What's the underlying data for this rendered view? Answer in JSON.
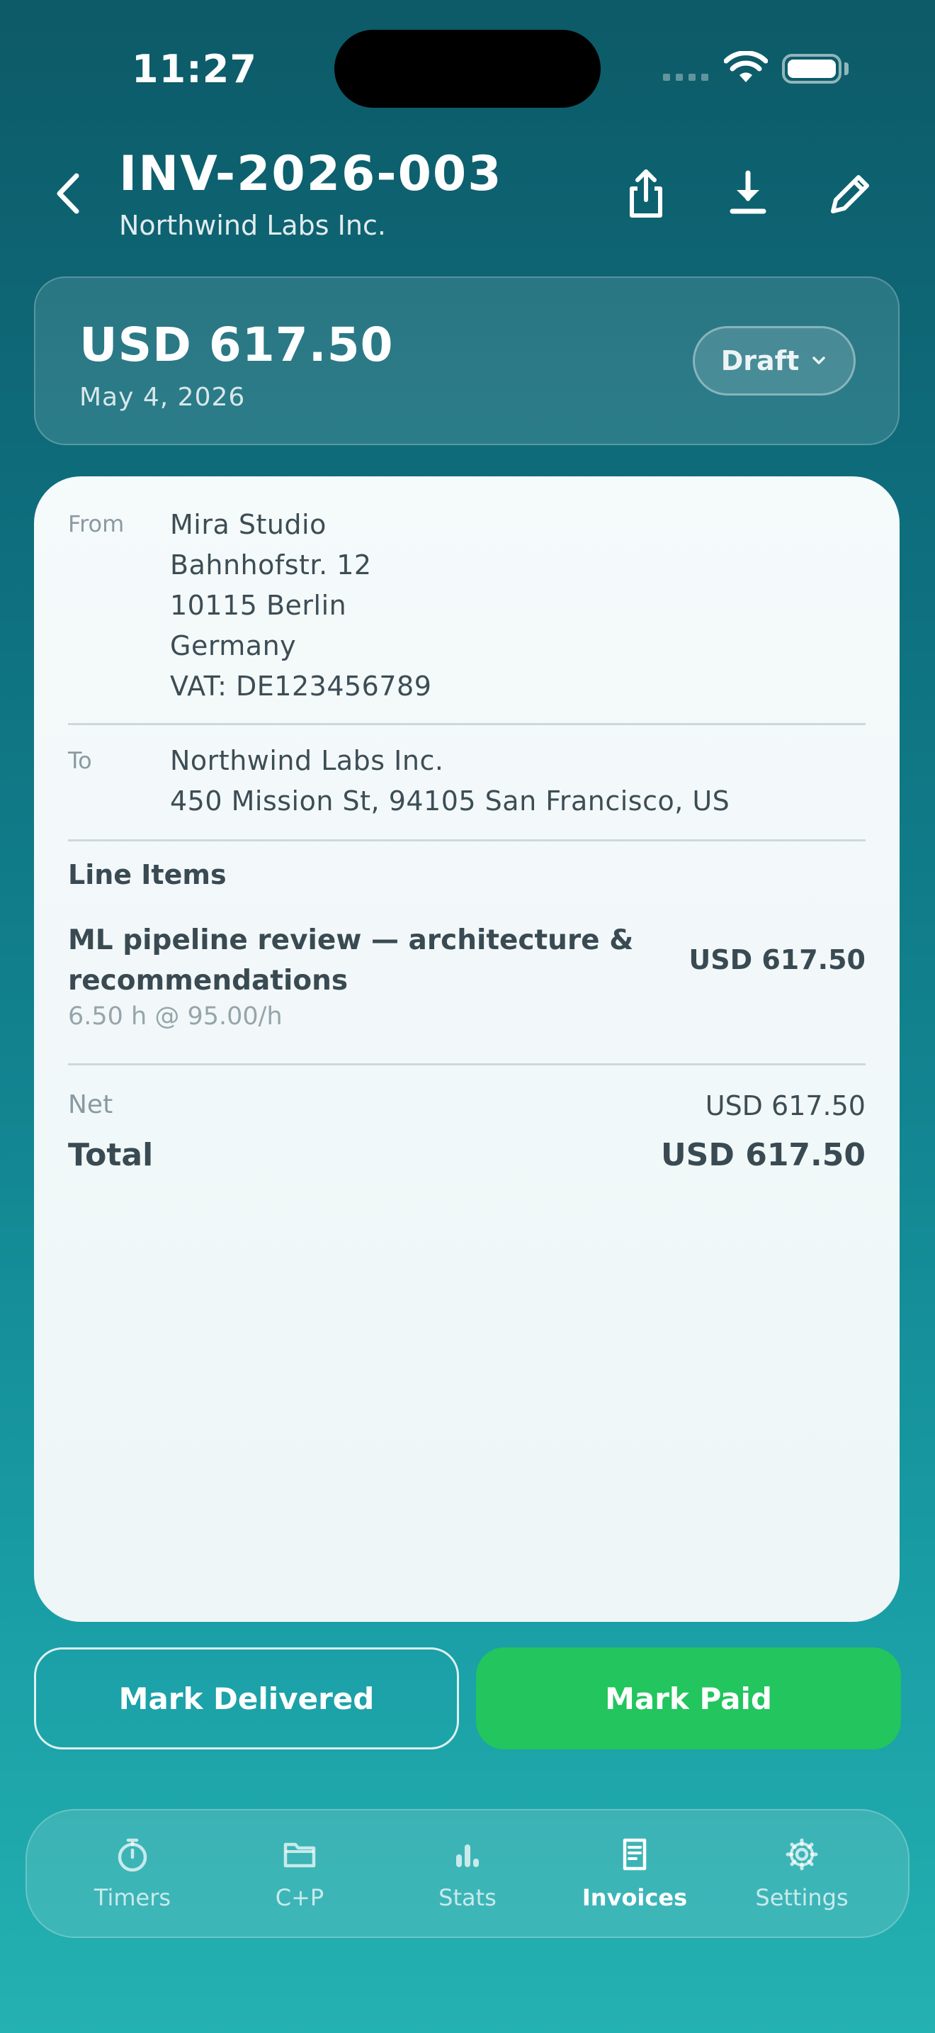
{
  "status_bar": {
    "time": "11:27"
  },
  "header": {
    "title": "INV-2026-003",
    "subtitle": "Northwind Labs Inc.",
    "actions": [
      "share-icon",
      "download-icon",
      "edit-icon"
    ]
  },
  "summary": {
    "amount": "USD 617.50",
    "date": "May 4, 2026",
    "status": "Draft"
  },
  "invoice": {
    "from_label": "From",
    "from_lines": [
      "Mira Studio",
      "Bahnhofstr. 12",
      "10115 Berlin",
      "Germany",
      "VAT: DE123456789"
    ],
    "to_label": "To",
    "to_lines": [
      "Northwind Labs Inc.",
      "450 Mission St, 94105 San Francisco, US"
    ],
    "line_items_title": "Line Items",
    "items": [
      {
        "desc_line1": "ML pipeline review — architecture &",
        "desc_line2": "recommendations",
        "meta": "6.50 h @ 95.00/h",
        "amount": "USD 617.50"
      }
    ],
    "net_label": "Net",
    "net_value": "USD 617.50",
    "total_label": "Total",
    "total_value": "USD 617.50"
  },
  "actions": {
    "mark_delivered": "Mark Delivered",
    "mark_paid": "Mark Paid"
  },
  "tabbar": {
    "items": [
      {
        "label": "Timers",
        "icon": "stopwatch-icon"
      },
      {
        "label": "C+P",
        "icon": "folder-icon"
      },
      {
        "label": "Stats",
        "icon": "bar-chart-icon"
      },
      {
        "label": "Invoices",
        "icon": "invoice-icon",
        "active": true
      },
      {
        "label": "Settings",
        "icon": "gear-icon"
      }
    ]
  },
  "colors": {
    "accent_green": "#22c55e",
    "background_top": "#0d5a68",
    "background_bottom": "#24b1b1"
  }
}
